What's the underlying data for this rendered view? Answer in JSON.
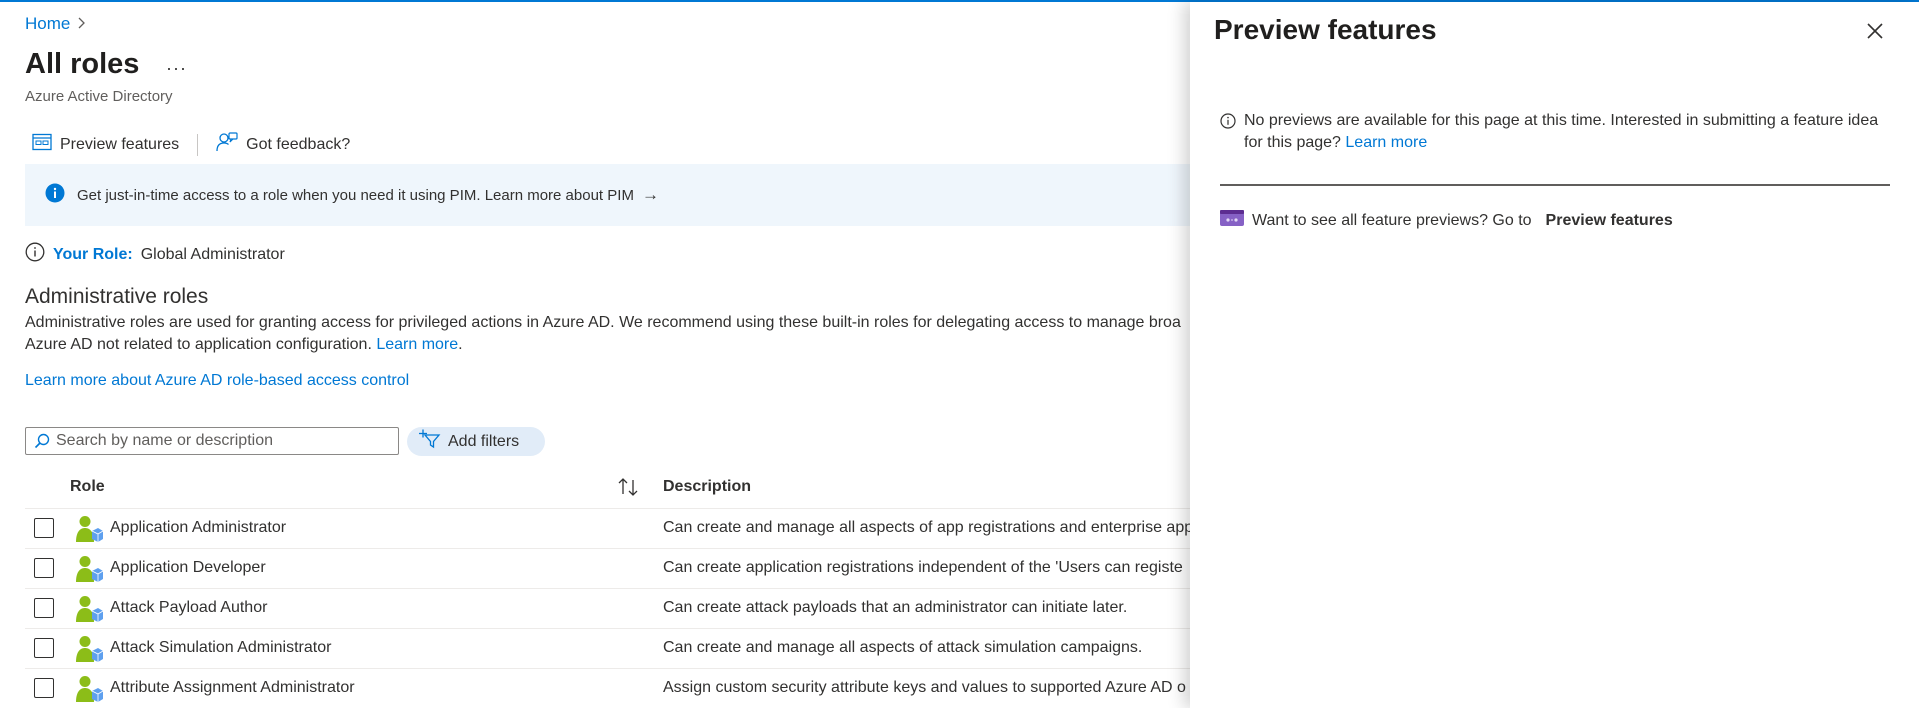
{
  "breadcrumb": {
    "home": "Home"
  },
  "header": {
    "title": "All roles",
    "more": "···",
    "subtitle": "Azure Active Directory"
  },
  "toolbar": {
    "preview_label": "Preview features",
    "feedback_label": "Got feedback?"
  },
  "pim": {
    "text": "Get just-in-time access to a role when you need it using PIM. Learn more about PIM",
    "arrow": "→"
  },
  "role": {
    "label": "Your Role:",
    "value": "Global Administrator"
  },
  "section": {
    "title": "Administrative roles",
    "desc_line1": "Administrative roles are used for granting access for privileged actions in Azure AD. We recommend using these built-in roles for delegating access to manage broa",
    "desc_line2_prefix": "Azure AD not related to application configuration. ",
    "learn_more": "Learn more",
    "desc_line2_suffix": ".",
    "rbac_link": "Learn more about Azure AD role-based access control"
  },
  "search": {
    "placeholder": "Search by name or description"
  },
  "filters": {
    "label": "Add filters"
  },
  "table": {
    "col_role": "Role",
    "col_desc": "Description",
    "rows": [
      {
        "name": "Application Administrator",
        "desc": "Can create and manage all aspects of app registrations and enterprise app"
      },
      {
        "name": "Application Developer",
        "desc": "Can create application registrations independent of the 'Users can registe"
      },
      {
        "name": "Attack Payload Author",
        "desc": "Can create attack payloads that an administrator can initiate later."
      },
      {
        "name": "Attack Simulation Administrator",
        "desc": "Can create and manage all aspects of attack simulation campaigns."
      },
      {
        "name": "Attribute Assignment Administrator",
        "desc": "Assign custom security attribute keys and values to supported Azure AD o"
      }
    ]
  },
  "panel": {
    "title": "Preview features",
    "notice_text": "No previews are available for this page at this time. Interested in submitting a feature idea for this page?",
    "notice_link": "Learn more",
    "goto_text": "Want to see all feature previews? Go to",
    "goto_link": "Preview features"
  },
  "colors": {
    "accent": "#0078d4",
    "banner_bg": "#eff6fc",
    "filter_bg": "#e1ecf8"
  },
  "icons": {
    "close": "close-icon",
    "info": "info-icon",
    "preview": "preview-features-icon",
    "feedback": "feedback-icon",
    "search": "search-icon",
    "filter": "filter-icon",
    "sort": "sort-icon",
    "role": "role-user-icon"
  }
}
